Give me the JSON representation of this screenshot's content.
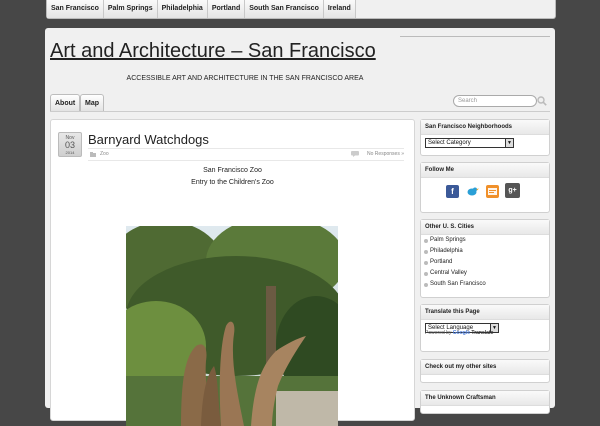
{
  "top_nav": [
    "San Francisco",
    "Palm Springs",
    "Philadelphia",
    "Portland",
    "South San Francisco",
    "Ireland"
  ],
  "site": {
    "title": "Art and Architecture – San Francisco",
    "tagline": "ACCESSIBLE ART AND ARCHITECTURE IN THE SAN FRANCISCO AREA"
  },
  "tabs": [
    "About",
    "Map"
  ],
  "search": {
    "placeholder": "Search"
  },
  "post": {
    "date": {
      "month": "Nov",
      "day": "03",
      "year": "2014"
    },
    "title": "Barnyard Watchdogs",
    "category": "Zoo",
    "responses": "No Responses »",
    "lines": [
      "San Francisco Zoo",
      "Entry to the Children's Zoo"
    ]
  },
  "sidebar": {
    "neighborhoods": {
      "title": "San Francisco Neighborhoods",
      "select_value": "Select Category"
    },
    "follow": {
      "title": "Follow Me",
      "icons": [
        "facebook-icon",
        "twitter-icon",
        "rss-icon",
        "google-plus-icon"
      ]
    },
    "other_cities": {
      "title": "Other U. S. Cities",
      "items": [
        "Palm Springs",
        "Philadelphia",
        "Portland",
        "Central Valley",
        "South San Francisco"
      ]
    },
    "translate": {
      "title": "Translate this Page",
      "select_value": "Select Language",
      "powered_by": "Powered by",
      "google": "Google",
      "translate": "Translate"
    },
    "other_sites": {
      "title": "Check out my other sites"
    },
    "unknown": {
      "title": "The Unknown Craftsman"
    }
  },
  "colors": {
    "background": "#474747",
    "panel": "#f0f0f0",
    "facebook": "#3b5998",
    "rss": "#f0902a",
    "google_plus": "#555555"
  }
}
